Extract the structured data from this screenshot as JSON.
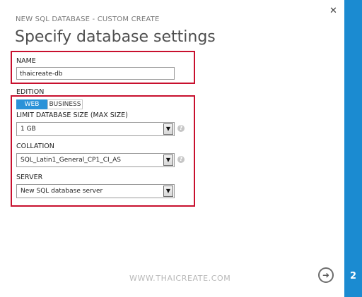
{
  "header": {
    "subtitle": "NEW SQL DATABASE - CUSTOM CREATE",
    "title": "Specify database settings",
    "close_icon": "close-icon"
  },
  "form": {
    "name_label": "NAME",
    "name_value": "thaicreate-db",
    "edition_label": "EDITION",
    "edition_options": [
      "WEB",
      "BUSINESS"
    ],
    "edition_selected": "WEB",
    "size_label": "LIMIT DATABASE SIZE (MAX SIZE)",
    "size_value": "1 GB",
    "collation_label": "COLLATION",
    "collation_value": "SQL_Latin1_General_CP1_CI_AS",
    "server_label": "SERVER",
    "server_value": "New SQL database server",
    "help_icon": "question-icon"
  },
  "footer": {
    "watermark": "WWW.THAICREATE.COM",
    "next_icon": "arrow-right-icon",
    "page_number": "2"
  },
  "colors": {
    "accent": "#1b8bd1",
    "highlight": "#c8102e",
    "tab_selected": "#2b92d8"
  }
}
